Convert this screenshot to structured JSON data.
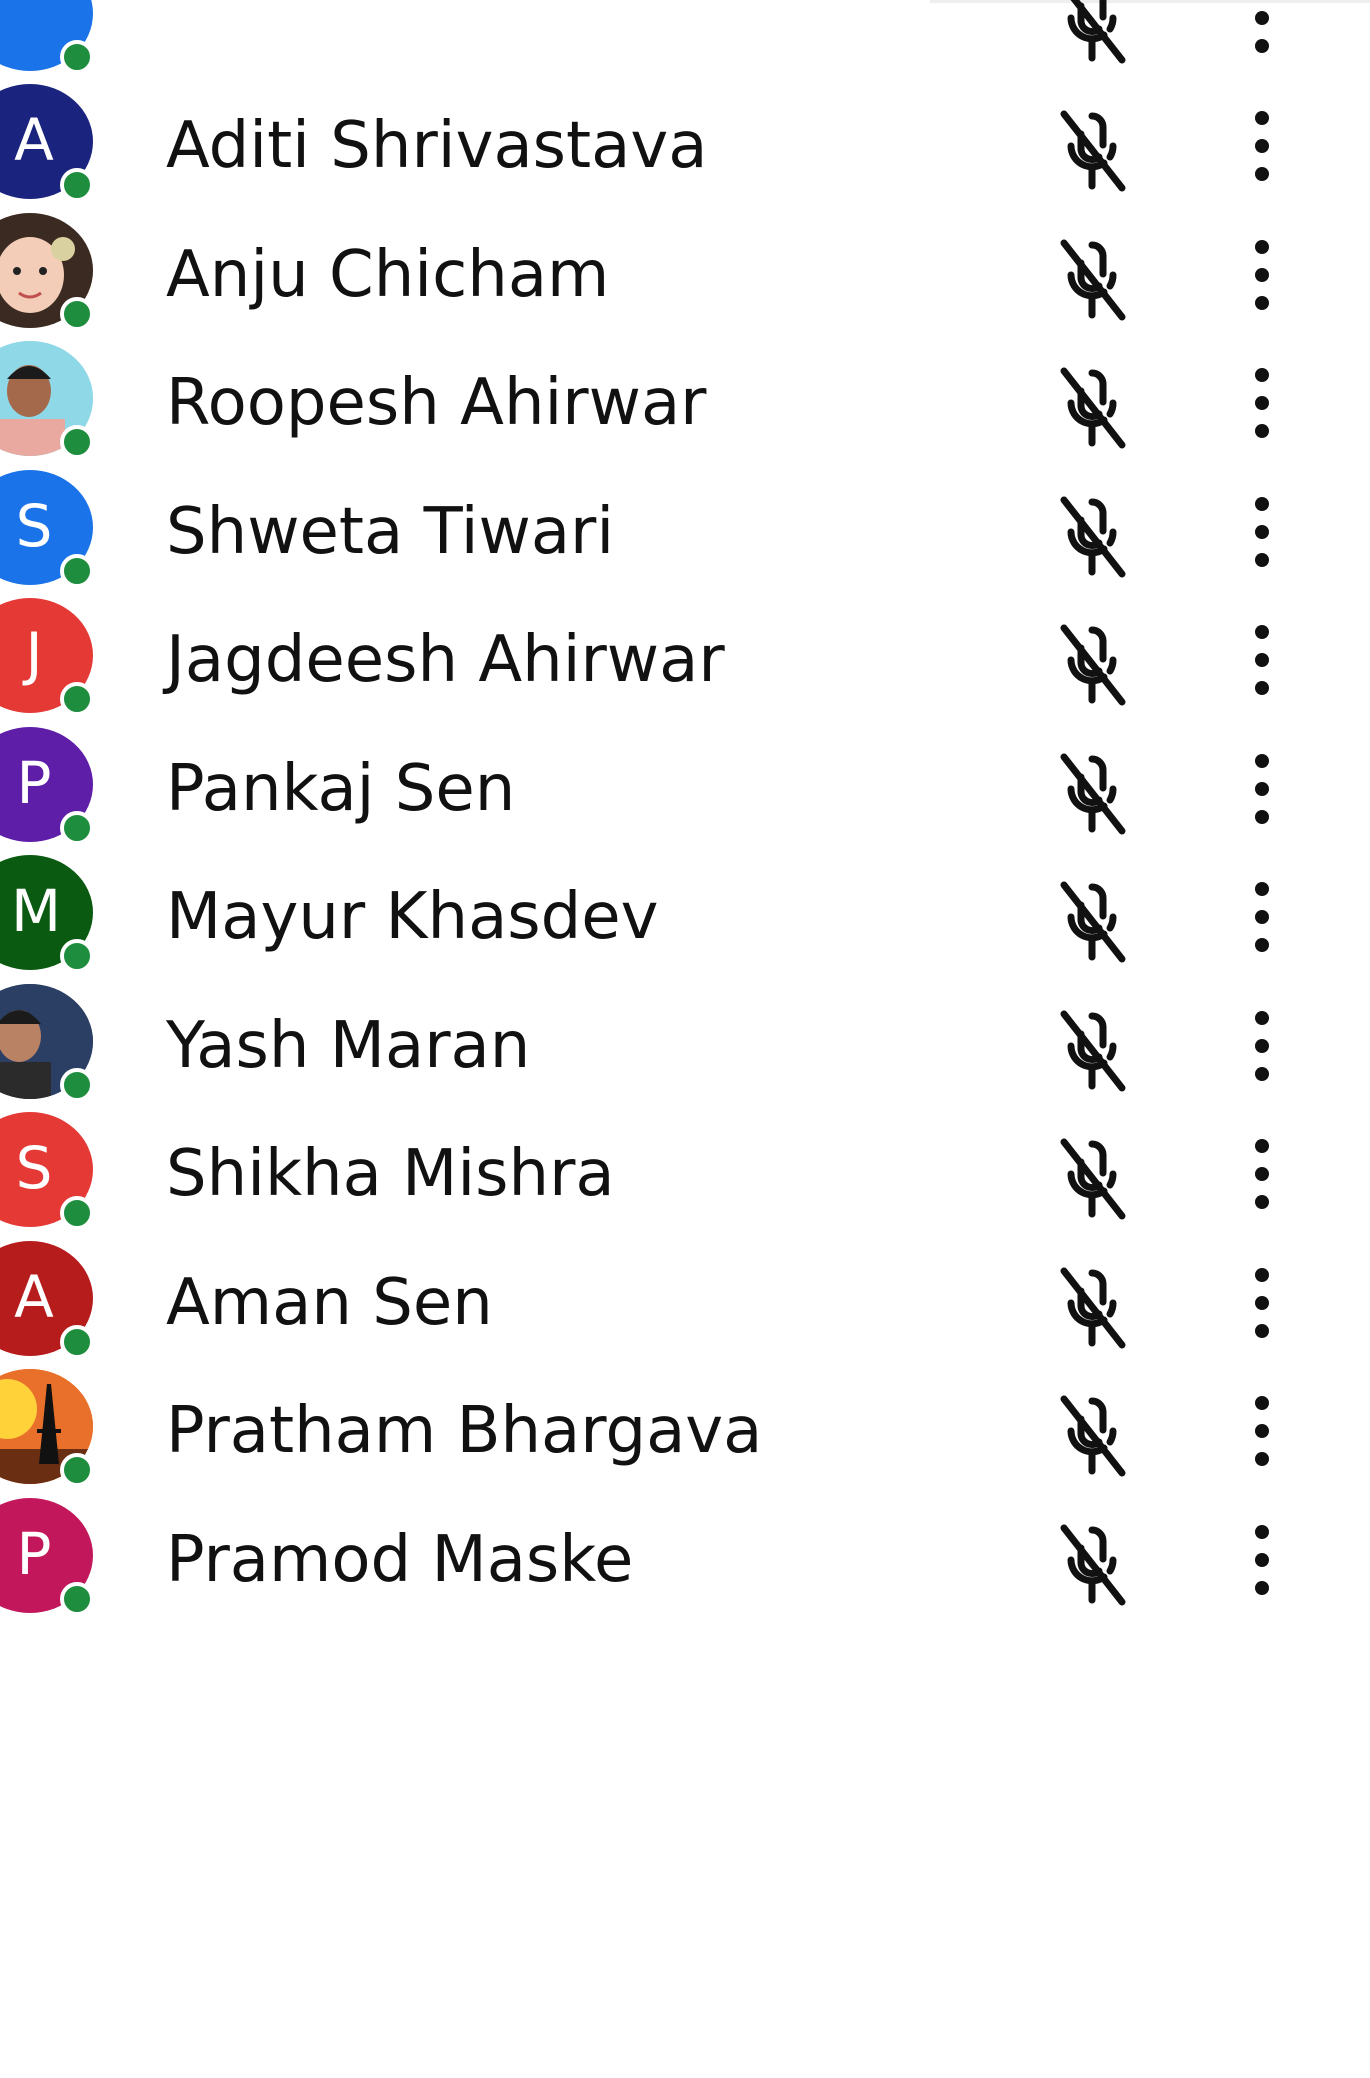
{
  "participants": [
    {
      "name": "Aditi Shrivastava",
      "initial": "A",
      "color": "#1a237e",
      "photo": false
    },
    {
      "name": "Anju Chicham",
      "initial": "",
      "color": "#c9b9a5",
      "photo": true,
      "photo_icon": "child-photo"
    },
    {
      "name": "Roopesh Ahirwar",
      "initial": "",
      "color": "#8fd8e8",
      "photo": true,
      "photo_icon": "man-photo"
    },
    {
      "name": "Shweta Tiwari",
      "initial": "S",
      "color": "#1a73e8",
      "photo": false
    },
    {
      "name": "Jagdeesh Ahirwar",
      "initial": "J",
      "color": "#e53935",
      "photo": false
    },
    {
      "name": "Pankaj Sen",
      "initial": "P",
      "color": "#5e1ea8",
      "photo": false
    },
    {
      "name": "Mayur Khasdev",
      "initial": "M",
      "color": "#0b5a12",
      "photo": false
    },
    {
      "name": "Yash Maran",
      "initial": "",
      "color": "#2b3e63",
      "photo": true,
      "photo_icon": "man-photo-dark"
    },
    {
      "name": "Shikha Mishra",
      "initial": "S",
      "color": "#e53935",
      "photo": false
    },
    {
      "name": "Aman Sen",
      "initial": "A",
      "color": "#b71c1c",
      "photo": false
    },
    {
      "name": "Pratham Bhargava",
      "initial": "",
      "color": "#e8702a",
      "photo": true,
      "photo_icon": "eiffel-tower-photo"
    },
    {
      "name": "Pramod Maske",
      "initial": "P",
      "color": "#c2185b",
      "photo": false
    }
  ],
  "online_color": "#1e8e3e",
  "mic_state": "muted",
  "icons": {
    "mic": "mic-off-icon",
    "more": "more-vert-icon"
  }
}
